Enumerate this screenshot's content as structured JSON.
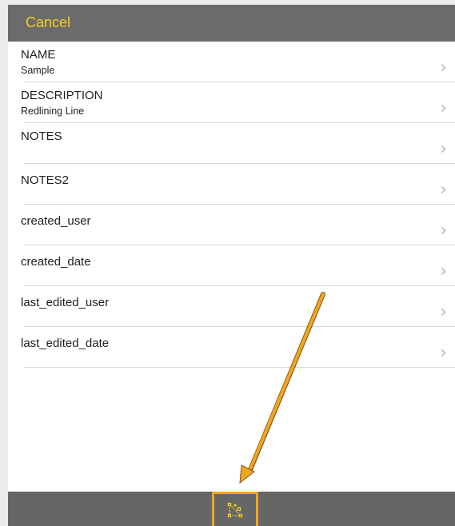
{
  "navbar": {
    "cancel_label": "Cancel"
  },
  "fields": [
    {
      "name": "NAME",
      "value": "Sample"
    },
    {
      "name": "DESCRIPTION",
      "value": "Redlining Line"
    },
    {
      "name": "NOTES",
      "value": ""
    },
    {
      "name": "NOTES2",
      "value": ""
    },
    {
      "name": "created_user",
      "value": ""
    },
    {
      "name": "created_date",
      "value": ""
    },
    {
      "name": "last_edited_user",
      "value": ""
    },
    {
      "name": "last_edited_date",
      "value": ""
    }
  ],
  "toolbar": {
    "edit_vertices_icon": "edit-vertices-icon"
  },
  "annotation": {
    "arrow_color": "#f2a51e"
  },
  "colors": {
    "accent": "#f2d01e",
    "highlight": "#f2a51e",
    "bar": "#6b6b6b"
  }
}
